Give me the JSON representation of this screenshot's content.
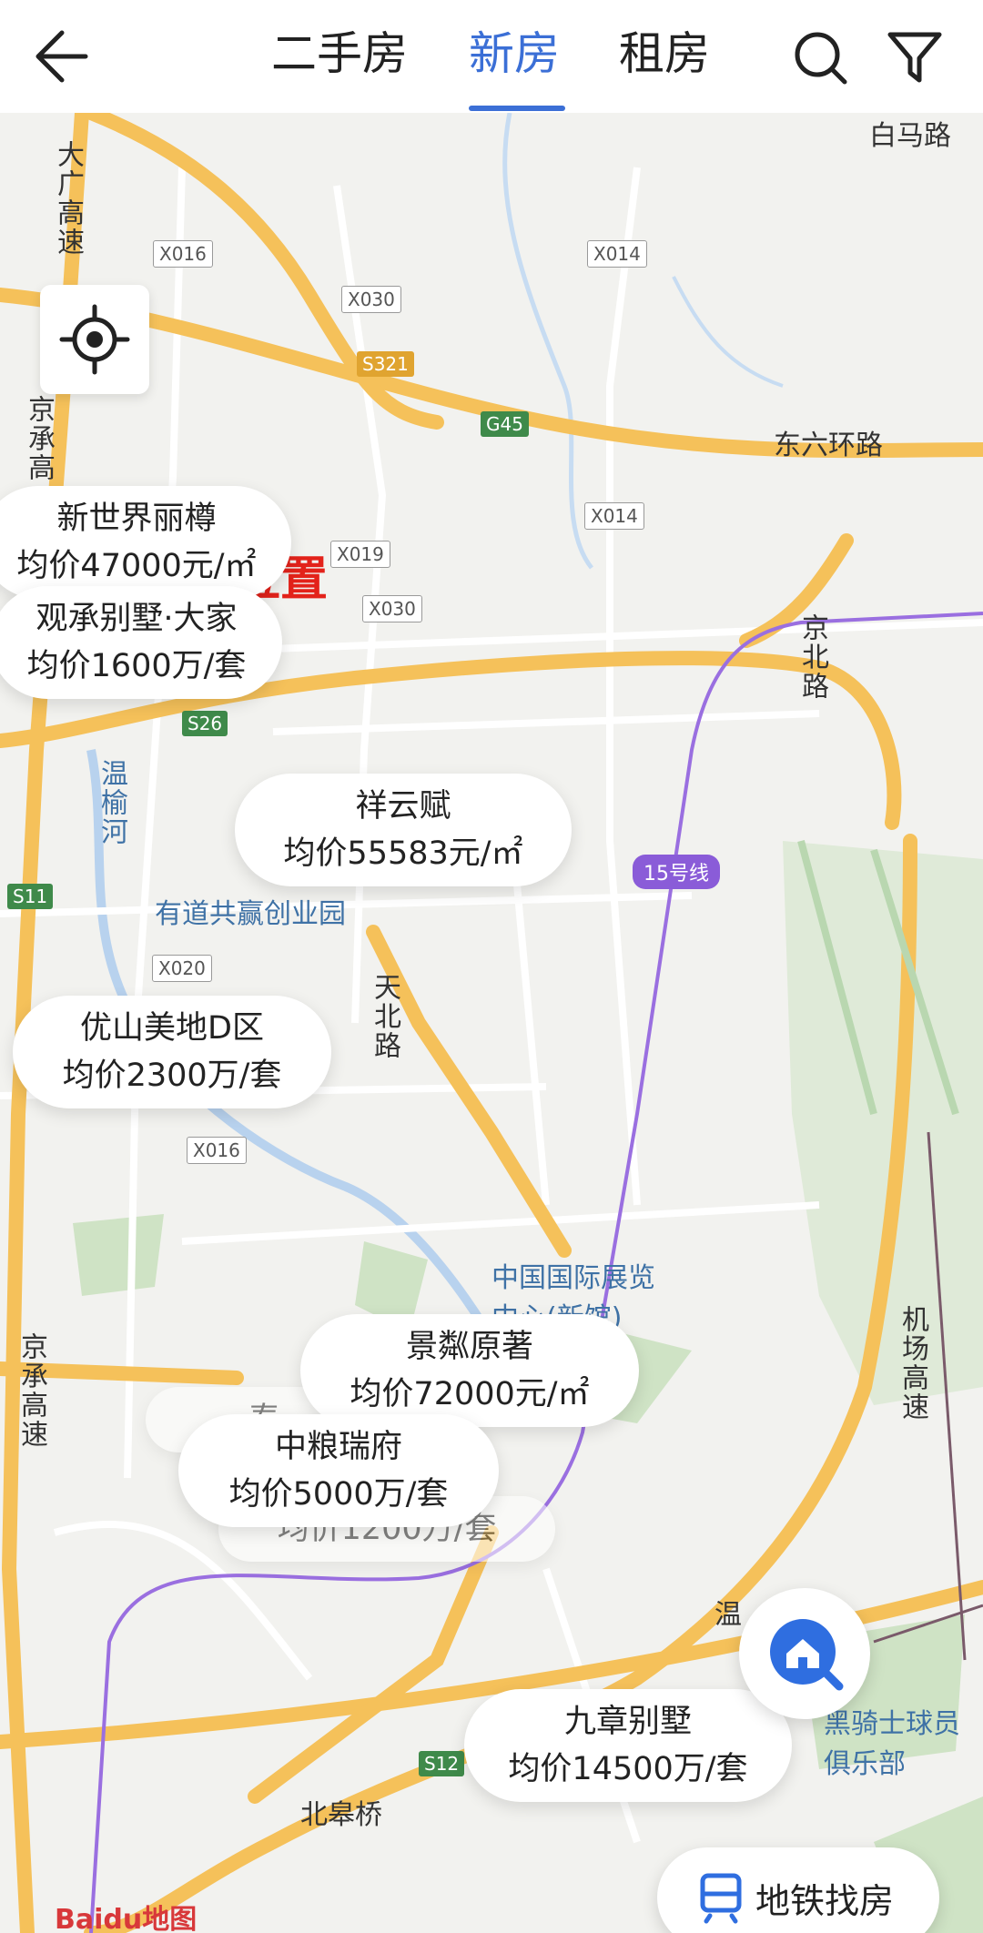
{
  "header": {
    "tabs": [
      {
        "label": "二手房",
        "active": false
      },
      {
        "label": "新房",
        "active": true
      },
      {
        "label": "租房",
        "active": false
      }
    ],
    "back_icon": "arrow-left-icon",
    "search_icon": "search-icon",
    "filter_icon": "filter-icon",
    "accent_color": "#3b6fd6"
  },
  "map": {
    "plot_label": "▲地块位置",
    "listings": [
      {
        "name": "新世界丽樽",
        "price": "均价47000元/㎡"
      },
      {
        "name": "观承别墅·大家",
        "price": "均价1600万/套"
      },
      {
        "name": "祥云赋",
        "price": "均价55583元/㎡"
      },
      {
        "name": "优山美地D区",
        "price": "均价2300万/套"
      },
      {
        "name": "景粼原著",
        "price": "均价72000元/㎡"
      },
      {
        "name": "中粮瑞府",
        "price": "均价5000万/套"
      },
      {
        "name": "九章别墅",
        "price": "均价14500万/套"
      }
    ],
    "faded_labels": {
      "tai": "泰",
      "price_1200": "均价1200万/套"
    },
    "place_labels": {
      "baima": "白马路",
      "dongliu": "东六环路",
      "daguang": "大广高速",
      "jingcheng_top": "京承高",
      "jingcheng_bottom": "京承高速",
      "jingbei": "京北路",
      "wenyu": "温榆河",
      "tianbei": "天北路",
      "youdao": "有道共赢创业园",
      "expo": "中国国际展览中心(新馆)",
      "airport_hw": "机场高速",
      "beigao": "北皋桥",
      "club": "黑骑士球员俱乐部",
      "wen": "温",
      "baidu": "Baidu地图"
    },
    "road_tags": [
      "X016",
      "X030",
      "X014",
      "X019",
      "X030",
      "X014",
      "X020",
      "X016"
    ],
    "hw_tags": [
      "S321",
      "G45",
      "S11",
      "S12",
      "S26"
    ],
    "line_tag": "15号线"
  },
  "buttons": {
    "locate_icon": "crosshair-icon",
    "home_icon": "home-search-icon",
    "subway_label": "地铁找房",
    "subway_icon": "subway-icon"
  }
}
